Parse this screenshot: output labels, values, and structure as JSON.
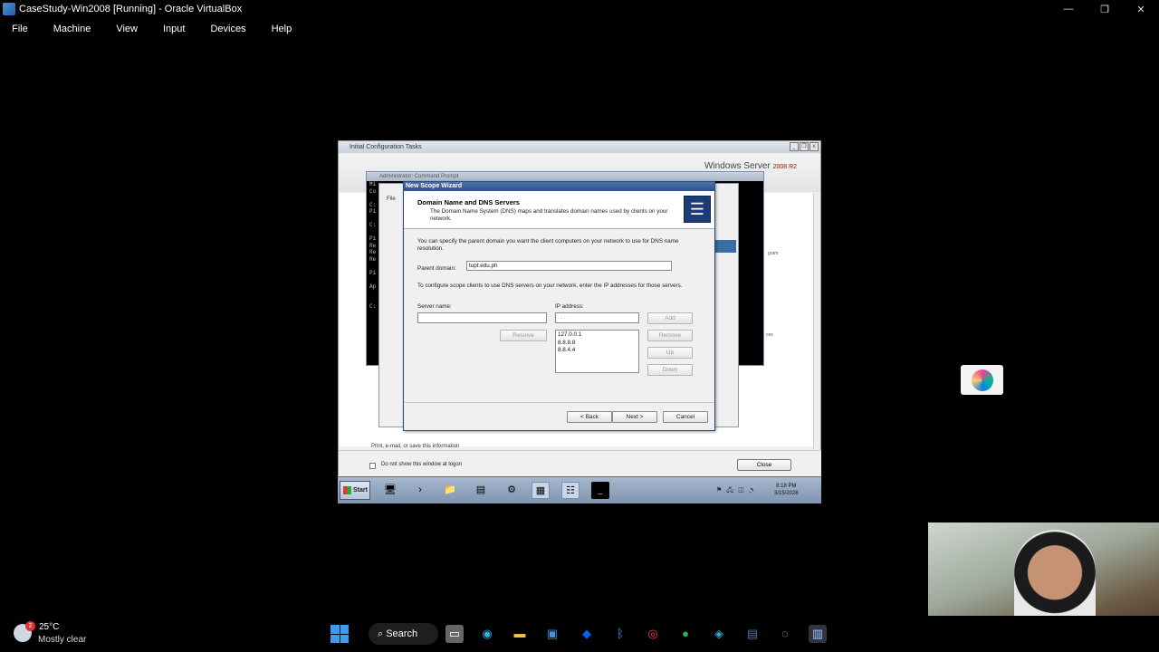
{
  "host": {
    "window_title": "CaseStudy-Win2008 [Running] - Oracle VirtualBox",
    "controls": {
      "minimize": "—",
      "restore": "❐",
      "close": "✕"
    },
    "menu": [
      "File",
      "Machine",
      "View",
      "Input",
      "Devices",
      "Help"
    ],
    "taskbar": {
      "weather_badge": "2",
      "temperature": "25°C",
      "condition": "Mostly clear",
      "search_label": "Search"
    }
  },
  "guest": {
    "ict_window": {
      "title": "Initial Configuration Tasks",
      "logo_text": "Windows Server",
      "logo_version": "2008 R2",
      "footer_link": "Print, e-mail, or save this information",
      "checkbox_label": "Do not show this window at logon",
      "close_label": "Close"
    },
    "cmd_window": {
      "title": "Administrator: Command Prompt",
      "lines": [
        "Mi",
        "Co",
        "",
        "C:",
        "Pi",
        "",
        "C:",
        "",
        "Pi",
        "Re",
        "Re",
        "Re",
        "",
        "Pi",
        "",
        "Ap",
        "",
        "",
        "C:"
      ]
    },
    "mmc_window": {
      "menu_file": "File",
      "side_text_1": "gram",
      "side_text_2": "ces"
    },
    "wizard": {
      "title": "New Scope Wizard",
      "heading": "Domain Name and DNS Servers",
      "subheading": "The Domain Name System (DNS) maps and translates domain names used by clients on your network.",
      "intro": "You can specify the parent domain you want the client computers on your network to use for DNS name resolution.",
      "parent_domain_label": "Parent domain:",
      "parent_domain_value": "tupt.edu.ph",
      "configure_text": "To configure scope clients to use DNS servers on your network, enter the IP addresses for those servers.",
      "server_name_label": "Server name:",
      "ip_address_label": "IP address:",
      "ip_placeholder": " .  .  . ",
      "resolve_label": "Resolve",
      "add_label": "Add",
      "remove_label": "Remove",
      "up_label": "Up",
      "down_label": "Down",
      "ip_list": [
        "127.0.0.1",
        "8.8.8.8",
        "8.8.4.4"
      ],
      "back_label": "< Back",
      "next_label": "Next >",
      "cancel_label": "Cancel"
    },
    "taskbar": {
      "start_label": "Start",
      "clock_time": "8:18 PM",
      "clock_date": "3/15/2026"
    }
  }
}
